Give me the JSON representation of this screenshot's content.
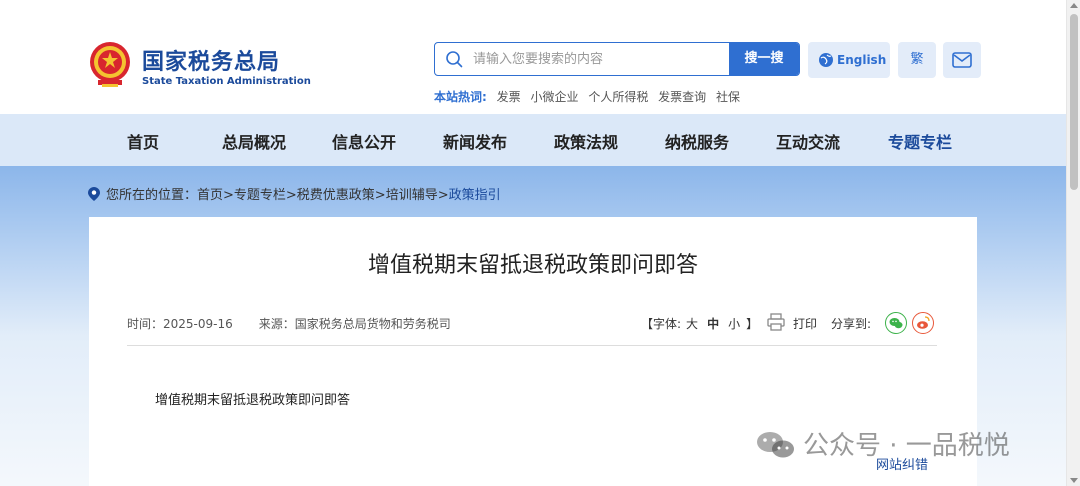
{
  "header": {
    "logo_cn": "国家税务总局",
    "logo_en": "State Taxation Administration",
    "search": {
      "placeholder": "请输入您要搜索的内容",
      "button": "搜一搜"
    },
    "english_label": "English",
    "traditional_label": "繁",
    "hot_label": "本站热词:",
    "hot_words": [
      "发票",
      "小微企业",
      "个人所得税",
      "发票查询",
      "社保"
    ]
  },
  "nav": {
    "items": [
      "首页",
      "总局概况",
      "信息公开",
      "新闻发布",
      "政策法规",
      "纳税服务",
      "互动交流",
      "专题专栏"
    ],
    "active": "专题专栏"
  },
  "breadcrumb": {
    "prefix": "您所在的位置：",
    "path": "首页>专题专栏>税费优惠政策>培训辅导>",
    "current": "政策指引"
  },
  "article": {
    "title": "增值税期末留抵退税政策即问即答",
    "time_label": "时间：",
    "time": "2025-09-16",
    "source_label": "来源：",
    "source": "国家税务总局货物和劳务税司",
    "font_size_open": "【字体:",
    "font_large": "大",
    "font_medium": "中",
    "font_small": "小",
    "font_size_close": "】",
    "print_label": "打印",
    "share_label": "分享到:",
    "body": "增值税期末留抵退税政策即问即答"
  },
  "watermark": "公众号 · 一品税悦",
  "correction_link": "网站纠错",
  "colors": {
    "brand_blue": "#1b4a9b",
    "accent_blue": "#2f6fd1",
    "nav_bg": "#dbe8f8"
  }
}
